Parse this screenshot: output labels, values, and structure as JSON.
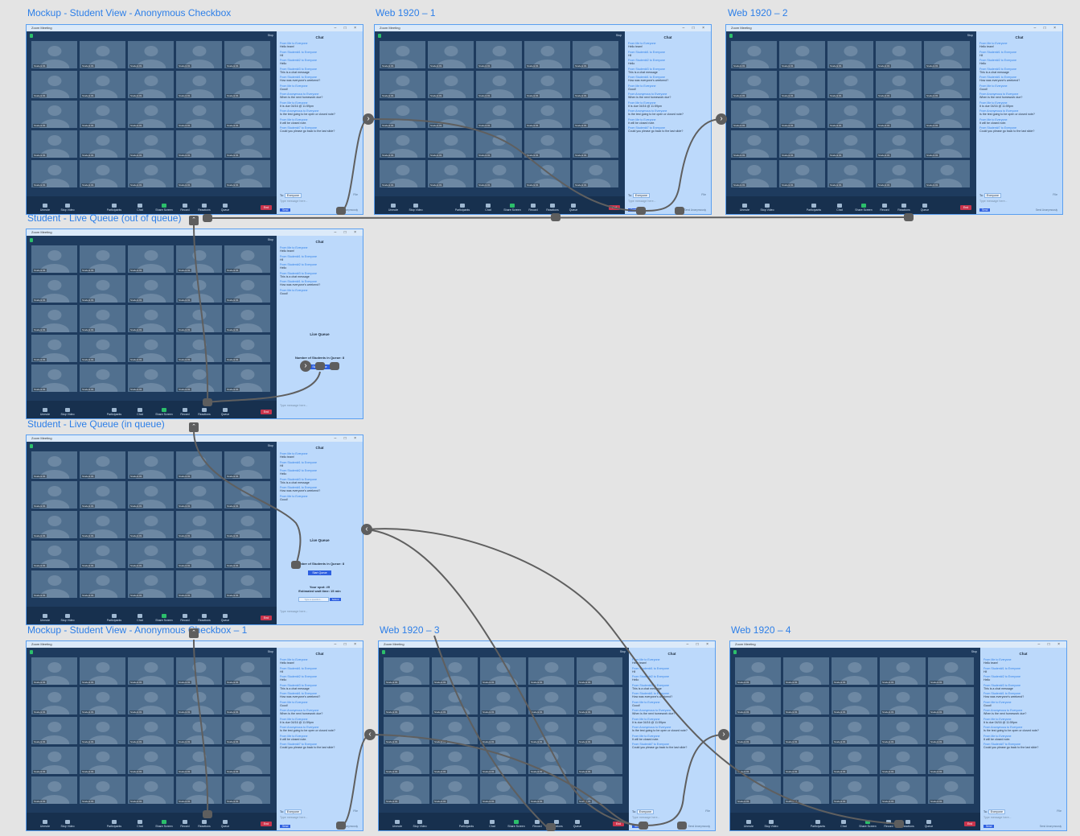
{
  "artboards": [
    {
      "title": "Mockup - Student View - Anonymous Checkbox",
      "variant": "chat-full"
    },
    {
      "title": "Web 1920 – 1",
      "variant": "chat-full"
    },
    {
      "title": "Web 1920 – 2",
      "variant": "chat-full"
    },
    {
      "title": "Student - Live Queue (out of queue)",
      "variant": "queue-out"
    },
    {
      "title": "Student - Live Queue (in queue)",
      "variant": "queue-in"
    },
    {
      "title": "Mockup - Student View - Anonymous Checkbox – 1",
      "variant": "chat-full"
    },
    {
      "title": "Web 1920 – 3",
      "variant": "chat-full"
    },
    {
      "title": "Web 1920 – 4",
      "variant": "chat-full"
    }
  ],
  "window": {
    "title": "Zoom Meeting",
    "stop": "Stop"
  },
  "tile_name": "Student #1",
  "toolbar": {
    "items": [
      "Unmute",
      "Stop Video",
      "Participants",
      "Chat",
      "Share Screen",
      "Record",
      "Reactions",
      "Queue"
    ],
    "end": "End"
  },
  "chat": {
    "title": "Chat",
    "messages": [
      {
        "from": "From Me to Everyone",
        "text": "Hello team!"
      },
      {
        "from": "From Student#1 to Everyone",
        "text": "Hi!"
      },
      {
        "from": "From Student#2 to Everyone",
        "text": "Hello"
      },
      {
        "from": "From Student#3 to Everyone",
        "text": "This is a chat message"
      },
      {
        "from": "From Student#1 to Everyone",
        "text": "How was everyone's weekend?"
      },
      {
        "from": "From Me to Everyone",
        "text": "Good!"
      },
      {
        "from": "From Anonymous to Everyone",
        "text": "When is the next homework due?"
      },
      {
        "from": "From Me to Everyone",
        "text": "It is due 04/16 @ 11:59pm"
      },
      {
        "from": "From Anonymous to Everyone",
        "text": "Is the test going to be open or closed note?"
      },
      {
        "from": "From Me to Everyone",
        "text": "It will be closed note."
      },
      {
        "from": "From Student#7 to Everyone",
        "text": "Could you please go back to the last slide?"
      }
    ],
    "to_label": "To:",
    "to_value": "Everyone",
    "file": "File",
    "placeholder": "Type message here...",
    "send": "Send",
    "anonymous": "Send Anonymously"
  },
  "queue": {
    "title": "Live Queue",
    "count": "Number of Students in Queue: 8",
    "start": "Start Queue",
    "spot": "Your spot: #9",
    "wait": "Estimated wait time: 15 min",
    "input_placeholder": "Type a question...",
    "submit": "Submit"
  }
}
